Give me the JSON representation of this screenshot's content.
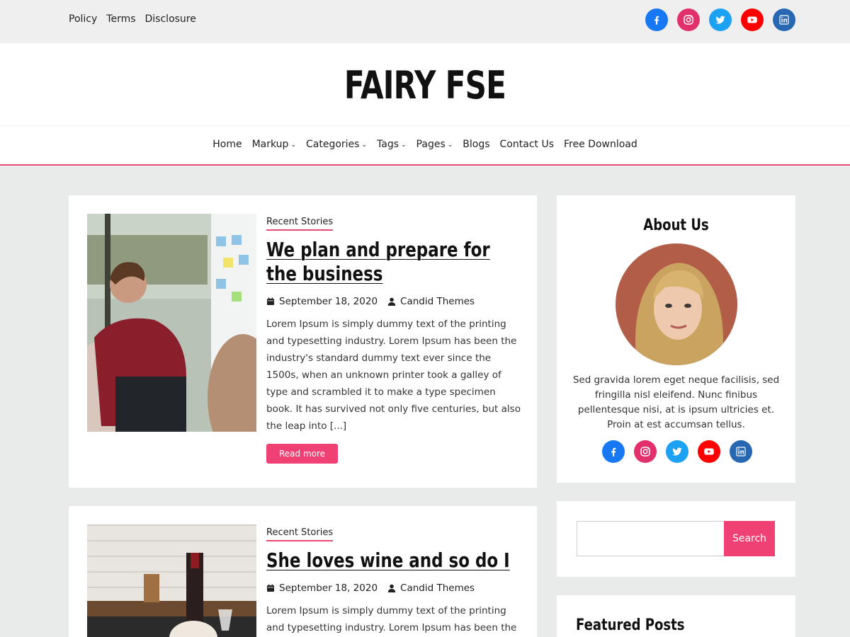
{
  "top_bar": {
    "links": [
      "Policy",
      "Terms",
      "Disclosure"
    ],
    "social": [
      {
        "name": "facebook-icon",
        "color": "#1877f2"
      },
      {
        "name": "instagram-icon",
        "color": "#e1306c"
      },
      {
        "name": "twitter-icon",
        "color": "#1da1f2"
      },
      {
        "name": "youtube-icon",
        "color": "#ff0000"
      },
      {
        "name": "linkedin-icon",
        "color": "#2867b2"
      }
    ]
  },
  "header": {
    "site_title": "FAIRY FSE"
  },
  "nav": {
    "items": [
      {
        "label": "Home",
        "dropdown": false
      },
      {
        "label": "Markup",
        "dropdown": true
      },
      {
        "label": "Categories",
        "dropdown": true
      },
      {
        "label": "Tags",
        "dropdown": true
      },
      {
        "label": "Pages",
        "dropdown": true
      },
      {
        "label": "Blogs",
        "dropdown": false
      },
      {
        "label": "Contact Us",
        "dropdown": false
      },
      {
        "label": "Free Download",
        "dropdown": false
      }
    ]
  },
  "posts": [
    {
      "category": "Recent Stories",
      "title": "We plan and prepare for the business",
      "date": "September 18, 2020",
      "author": "Candid Themes",
      "excerpt": "Lorem Ipsum is simply dummy text of the printing and typesetting industry. Lorem Ipsum has been the industry's standard dummy text ever since the 1500s, when an unknown printer took a galley of type and scrambled it to make a type specimen book. It has survived not only five centuries, but also the leap into [...]",
      "read_more": "Read more"
    },
    {
      "category": "Recent Stories",
      "title": "She loves wine and so do I",
      "date": "September 18, 2020",
      "author": "Candid Themes",
      "excerpt": "Lorem Ipsum is simply dummy text of the printing and typesetting industry. Lorem Ipsum has been the"
    }
  ],
  "sidebar": {
    "about": {
      "title": "About Us",
      "text": "Sed gravida lorem eget neque facilisis, sed fringilla nisl eleifend. Nunc finibus pellentesque nisi, at is ipsum ultricies et. Proin at est accumsan tellus."
    },
    "search": {
      "button": "Search",
      "placeholder": ""
    },
    "featured": {
      "title": "Featured Posts"
    }
  },
  "colors": {
    "accent": "#ef4174",
    "background": "#e8ebea"
  }
}
